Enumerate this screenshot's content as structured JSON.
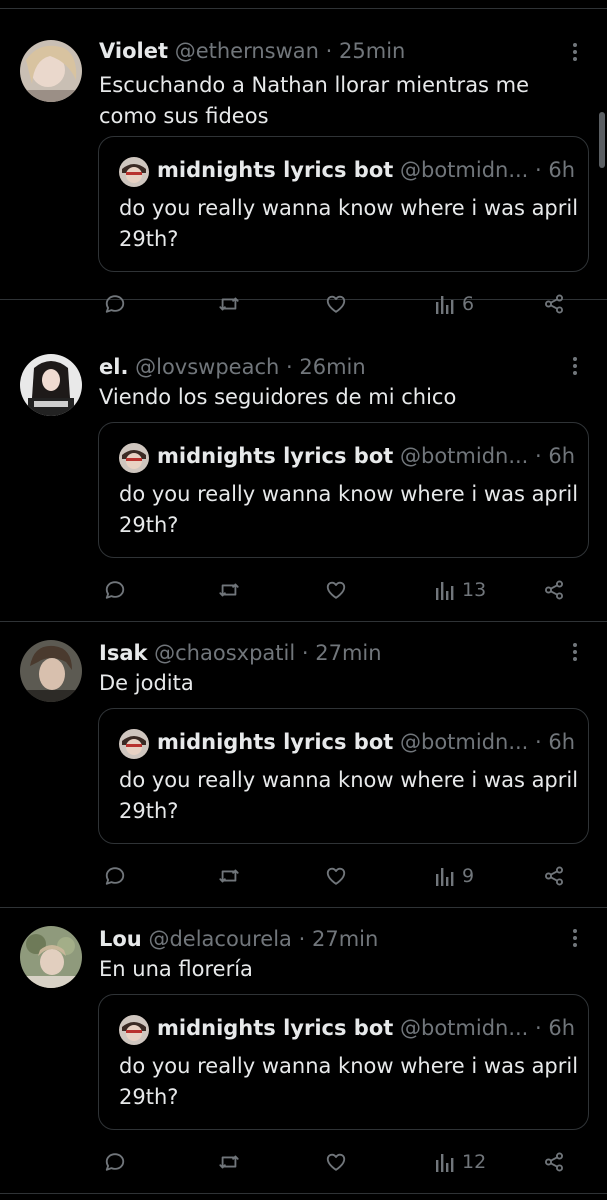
{
  "tweets": [
    {
      "name": "Violet",
      "handle": "@ethernswan",
      "sep": "·",
      "time": "25min",
      "text": "Escuchando a Nathan llorar mientras me como sus fideos",
      "quote": {
        "name": "midnights lyrics bot",
        "handle": "@botmidn...",
        "sep": "·",
        "time": "6h",
        "text": "do you really wanna know where i was april 29th?"
      },
      "views": "6"
    },
    {
      "name": "el.",
      "handle": "@lovswpeach",
      "sep": "·",
      "time": "26min",
      "text": "Viendo los seguidores de mi chico",
      "quote": {
        "name": "midnights lyrics bot",
        "handle": "@botmidn...",
        "sep": "·",
        "time": "6h",
        "text": "do you really wanna know where i was april 29th?"
      },
      "views": "13"
    },
    {
      "name": "Isak",
      "handle": "@chaosxpatil",
      "sep": "·",
      "time": "27min",
      "text": "De jodita",
      "quote": {
        "name": "midnights lyrics bot",
        "handle": "@botmidn...",
        "sep": "·",
        "time": "6h",
        "text": "do you really wanna know where i was april 29th?"
      },
      "views": "9"
    },
    {
      "name": "Lou",
      "handle": "@delacourela",
      "sep": "·",
      "time": "27min",
      "text": "En una florería",
      "quote": {
        "name": "midnights lyrics bot",
        "handle": "@botmidn...",
        "sep": "·",
        "time": "6h",
        "text": "do you really wanna know where i was april 29th?"
      },
      "views": "12"
    }
  ],
  "icons": {
    "reply": "reply-icon",
    "retweet": "retweet-icon",
    "like": "heart-icon",
    "views": "views-icon",
    "share": "share-icon",
    "more": "more-icon"
  },
  "colors": {
    "background": "#000000",
    "text": "#e7e9ea",
    "muted": "#71767b",
    "border": "#2f3336"
  }
}
